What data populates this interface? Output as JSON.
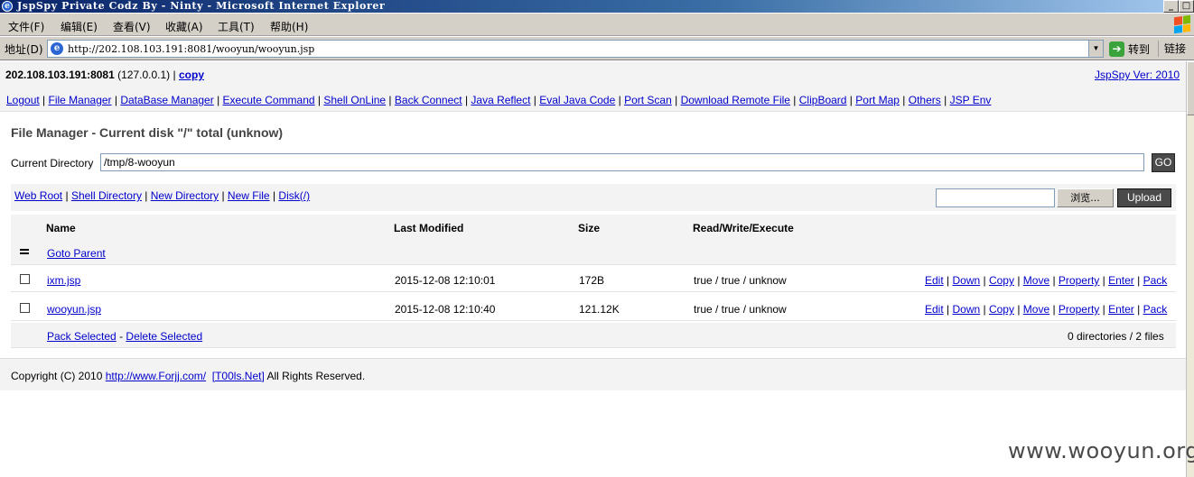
{
  "window": {
    "title": "JspSpy Private Codz By - Ninty - Microsoft Internet Explorer",
    "buttons": [
      "_",
      "□"
    ]
  },
  "menu": [
    "文件(F)",
    "编辑(E)",
    "查看(V)",
    "收藏(A)",
    "工具(T)",
    "帮助(H)"
  ],
  "address": {
    "label": "地址(D)",
    "url": "http://202.108.103.191:8081/wooyun/wooyun.jsp",
    "go_label": "转到",
    "links_label": "链接"
  },
  "header": {
    "host": "202.108.103.191:8081",
    "local": "(127.0.0.1)",
    "separator": "|",
    "copy": "copy",
    "version": "JspSpy Ver: 2010"
  },
  "nav": [
    "Logout",
    "File Manager",
    "DataBase Manager",
    "Execute Command",
    "Shell OnLine",
    "Back Connect",
    "Java Reflect",
    "Eval Java Code",
    "Port Scan",
    "Download Remote File",
    "ClipBoard",
    "Port Map",
    "Others",
    "JSP Env"
  ],
  "page": {
    "title": "File Manager - Current disk \"/\" total (unknow)",
    "current_dir_label": "Current Directory",
    "current_dir": "/tmp/8-wooyun",
    "go": "GO"
  },
  "toolbar": {
    "links": [
      "Web Root",
      "Shell Directory",
      "New Directory",
      "New File",
      "Disk(/)"
    ],
    "browse": "浏览...",
    "upload": "Upload"
  },
  "table": {
    "headers": {
      "name": "Name",
      "modified": "Last Modified",
      "size": "Size",
      "rwx": "Read/Write/Execute"
    },
    "parent": "Goto Parent",
    "actions": [
      "Edit",
      "Down",
      "Copy",
      "Move",
      "Property",
      "Enter",
      "Pack"
    ],
    "rows": [
      {
        "name": "ixm.jsp",
        "modified": "2015-12-08 12:10:01",
        "size": "172B",
        "rwx": "true / true / unknow"
      },
      {
        "name": "wooyun.jsp",
        "modified": "2015-12-08 12:10:40",
        "size": "121.12K",
        "rwx": "true / true / unknow"
      }
    ],
    "pack_selected": "Pack Selected",
    "dash": "-",
    "delete_selected": "Delete Selected",
    "summary": "0 directories / 2 files"
  },
  "footer": {
    "prefix": "Copyright (C) 2010",
    "link1": "http://www.Forjj.com/",
    "link2": "[T00ls.Net]",
    "suffix": "All Rights Reserved."
  },
  "watermark": "www.wooyun.org"
}
